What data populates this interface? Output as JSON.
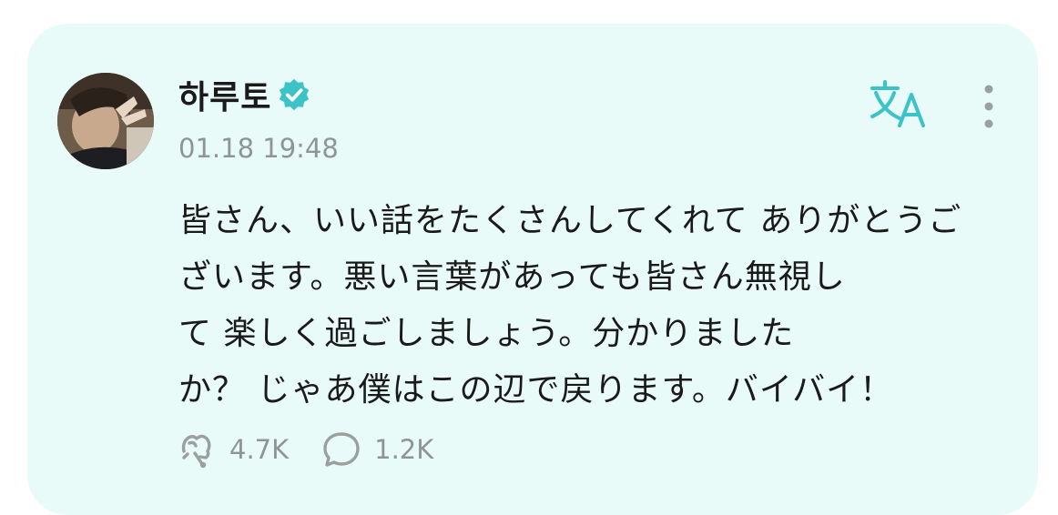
{
  "post": {
    "author": "하루토",
    "verified": true,
    "timestamp": "01.18 19:48",
    "text_lines": [
      "皆さん、いい話をたくさんしてくれて ありがとうご",
      "ざいます。悪い言葉があっても皆さん無視し",
      "て 楽しく過ごしましょう。分かりました",
      "か？ じゃあ僕はこの辺で戻ります。バイバイ！"
    ],
    "likes": "4.7K",
    "comments": "1.2K"
  },
  "icons": {
    "verified": "verified-badge-icon",
    "translate": "translate-icon",
    "more": "more-vertical-icon",
    "like": "like-icon",
    "comment": "comment-bubble-icon"
  },
  "colors": {
    "card_background": "#e8fbf8",
    "accent": "#3cc3c8",
    "muted_text": "#8e9593",
    "body_text": "#1a1a1a"
  }
}
